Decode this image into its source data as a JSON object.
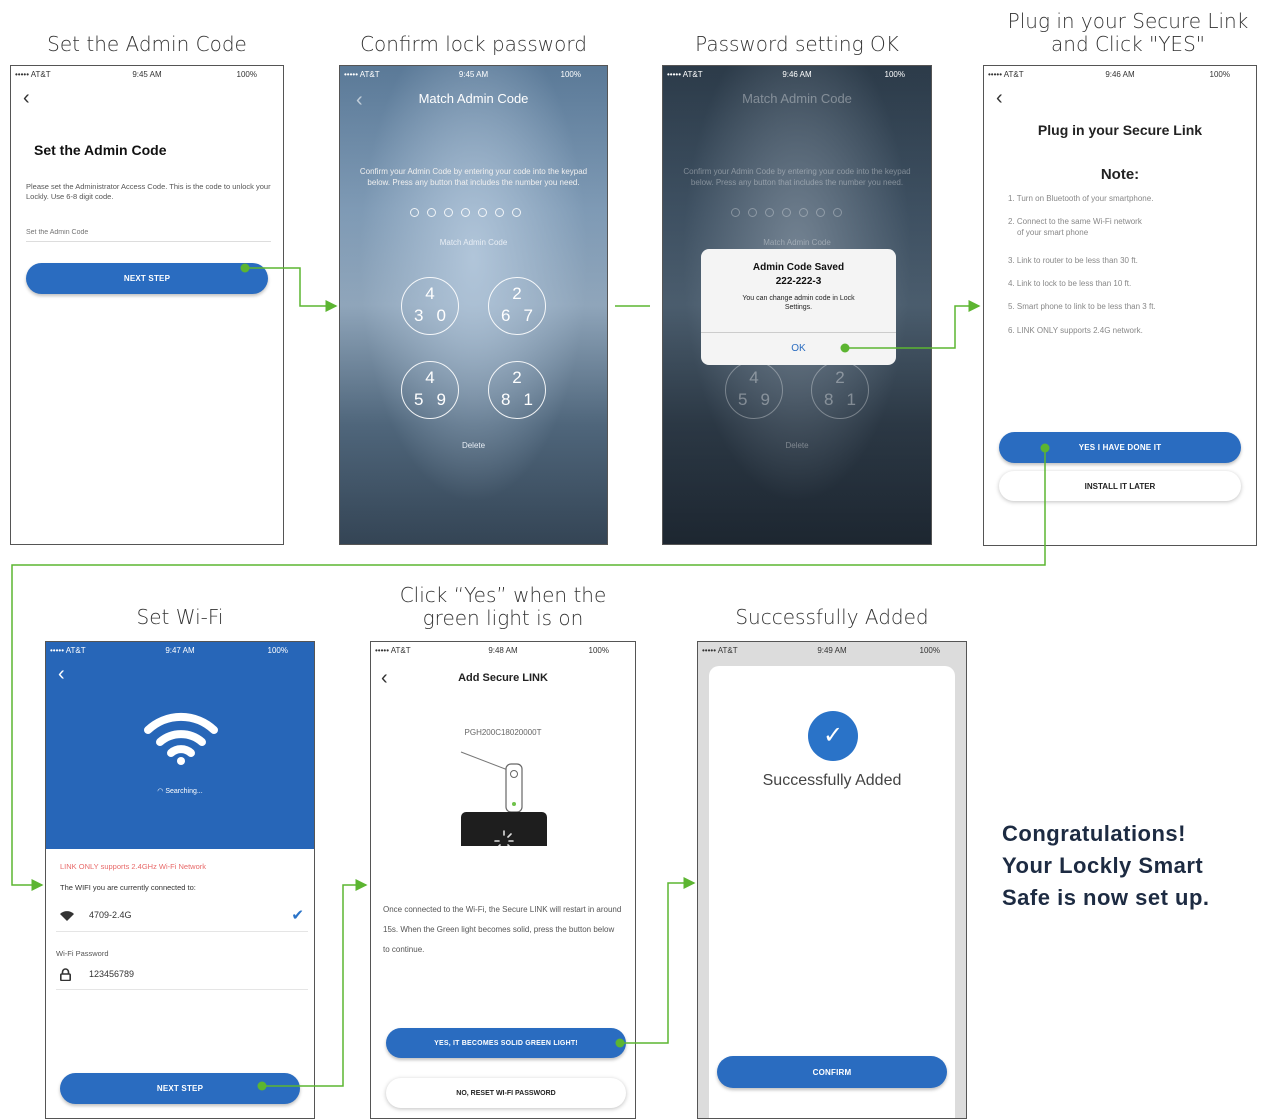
{
  "captions": {
    "step1": "Set the Admin Code",
    "step2": "Confirm lock password",
    "step3": "Password setting OK",
    "step4_line1": "Plug in your Secure Link",
    "step4_line2": "and Click \"YES\"",
    "step5": "Set Wi-Fi",
    "step6_line1": "Click “Yes” when the",
    "step6_line2": "green light is on",
    "step7": "Successfully Added"
  },
  "screen1": {
    "carrier": "••••• AT&T",
    "time": "9:45 AM",
    "battery": "100%",
    "title": "Set the Admin Code",
    "description": "Please set the Administrator Access Code. This is the code to unlock your Lockly. Use 6-8 digit code.",
    "input_placeholder": "Set the Admin Code",
    "next_label": "NEXT STEP"
  },
  "screen2": {
    "carrier": "••••• AT&T",
    "time": "9:45 AM",
    "battery": "100%",
    "title": "Match Admin Code",
    "instructions": "Confirm your Admin Code by entering your code into the keypad below. Press any button that includes the number you need.",
    "match_label": "Match Admin Code",
    "keys": [
      {
        "top": "4",
        "left": "3",
        "right": "0"
      },
      {
        "top": "2",
        "left": "6",
        "right": "7"
      },
      {
        "top": "4",
        "left": "5",
        "right": "9"
      },
      {
        "top": "2",
        "left": "8",
        "right": "1"
      }
    ],
    "delete_label": "Delete"
  },
  "screen3": {
    "carrier": "••••• AT&T",
    "time": "9:46 AM",
    "battery": "100%",
    "title": "Match Admin Code",
    "instructions": "Confirm your Admin Code by entering your code into the keypad below. Press any button that includes the number you need.",
    "match_label": "Match Admin Code",
    "dialog_title": "Admin Code Saved",
    "dialog_code": "222-222-3",
    "dialog_message": "You can change admin code in Lock Settings.",
    "dialog_ok": "OK",
    "keys": [
      {
        "top": "4",
        "left": "5",
        "right": "9"
      },
      {
        "top": "2",
        "left": "8",
        "right": "1"
      }
    ],
    "delete_label": "Delete"
  },
  "screen4": {
    "carrier": "••••• AT&T",
    "time": "9:46 AM",
    "battery": "100%",
    "title": "Plug in your Secure Link",
    "note_title": "Note:",
    "notes": [
      "1. Turn on Bluetooth of your smartphone.",
      "2. Connect to the same Wi-Fi network",
      "of your smart phone",
      "3. Link to router to be less than 30 ft.",
      "4. Link to lock to be less than 10 ft.",
      "5. Smart phone to link to be less than 3 ft.",
      "6. LINK ONLY supports 2.4G network."
    ],
    "yes_label": "YES I HAVE DONE IT",
    "later_label": "INSTALL IT LATER"
  },
  "screen5": {
    "carrier": "••••• AT&T",
    "time": "9:47 AM",
    "battery": "100%",
    "searching_label": "Searching...",
    "warning": "LINK ONLY supports 2.4GHz Wi-Fi Network",
    "connected_label": "The WIFI you are currently connected to:",
    "network_name": "4709-2.4G",
    "password_label": "Wi-Fi Password",
    "password_value": "123456789",
    "next_label": "NEXT STEP"
  },
  "screen6": {
    "carrier": "••••• AT&T",
    "time": "9:48 AM",
    "battery": "100%",
    "title": "Add Secure LINK",
    "serial": "PGH200C18020000T",
    "description": "Once connected to the Wi-Fi, the Secure LINK will restart in around 15s. When the Green light becomes solid, press the button below to continue.",
    "yes_label": "YES, IT BECOMES SOLID GREEN LIGHT!",
    "reset_label": "NO, RESET WI-FI PASSWORD"
  },
  "screen7": {
    "carrier": "••••• AT&T",
    "time": "9:49 AM",
    "battery": "100%",
    "message": "Successfully Added",
    "confirm_label": "CONFIRM"
  },
  "congrats": {
    "line1": "Congratulations!",
    "line2": "Your Lockly Smart",
    "line3": "Safe is now set up."
  },
  "colors": {
    "accent_blue": "#2a6cc0",
    "flow_green": "#5cb531",
    "warning_red": "#e86a6a",
    "success_blue": "#2a73c8"
  }
}
